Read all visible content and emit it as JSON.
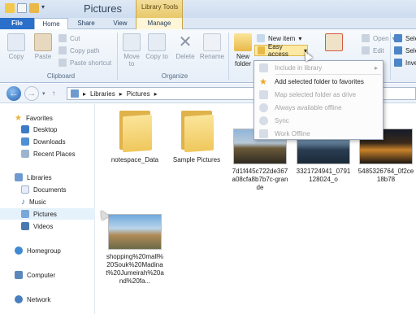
{
  "window": {
    "title": "Pictures",
    "context_header": "Library Tools"
  },
  "tabs": {
    "file": "File",
    "home": "Home",
    "share": "Share",
    "view": "View",
    "manage": "Manage"
  },
  "ribbon": {
    "clipboard": {
      "copy": "Copy",
      "paste": "Paste",
      "cut": "Cut",
      "copy_path": "Copy path",
      "paste_shortcut": "Paste shortcut",
      "label": "Clipboard"
    },
    "organize": {
      "move_to": "Move to",
      "copy_to": "Copy to",
      "delete": "Delete",
      "rename": "Rename",
      "label": "Organize"
    },
    "new": {
      "new_folder": "New folder",
      "new_item": "New item",
      "easy_access": "Easy access"
    },
    "open": {
      "open": "Open",
      "edit": "Edit"
    },
    "select": {
      "sel1": "Sele",
      "sel2": "Sele",
      "sel3": "Inve"
    }
  },
  "easy_access_menu": {
    "items": [
      {
        "label": "Include in library",
        "enabled": false
      },
      {
        "label": "Add selected folder to favorites",
        "enabled": true
      },
      {
        "label": "Map selected folder as drive",
        "enabled": false
      },
      {
        "label": "Always available offline",
        "enabled": false
      },
      {
        "label": "Sync",
        "enabled": false
      },
      {
        "label": "Work Offline",
        "enabled": false
      }
    ]
  },
  "address": {
    "crumb1": "Libraries",
    "crumb2": "Pictures"
  },
  "nav": {
    "favorites": "Favorites",
    "desktop": "Desktop",
    "downloads": "Downloads",
    "recent": "Recent Places",
    "libraries": "Libraries",
    "documents": "Documents",
    "music": "Music",
    "pictures": "Pictures",
    "videos": "Videos",
    "homegroup": "Homegroup",
    "computer": "Computer",
    "network": "Network"
  },
  "files": [
    {
      "name": "notespace_Data",
      "kind": "folder"
    },
    {
      "name": "Sample Pictures",
      "kind": "folder"
    },
    {
      "name": "7d1f445c722de367a08cfa8b7b7c-grande",
      "kind": "image"
    },
    {
      "name": "3321724941_0791128024_o",
      "kind": "image"
    },
    {
      "name": "5485326764_0f2ce18b78",
      "kind": "image"
    },
    {
      "name": "shopping%20mall%20Souk%20Madinat%20Jumeirah%20and%20fa...",
      "kind": "image"
    }
  ],
  "colors": {
    "accent": "#2a6fc9",
    "folder": "#efc75c",
    "highlight": "#fbe9a5",
    "context": "#e8c86a"
  }
}
